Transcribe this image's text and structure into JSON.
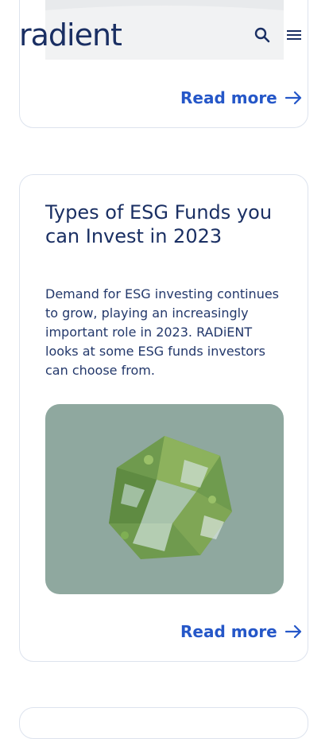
{
  "header": {
    "logo_text": "radient"
  },
  "cards": [
    {
      "read_more": "Read more"
    },
    {
      "title": "Types of ESG Funds you can Invest in 2023",
      "description": "Demand for ESG investing continues to grow, playing an increasingly important role in 2023. RADiENT looks at some ESG funds investors can choose from.",
      "read_more": "Read more"
    }
  ],
  "colors": {
    "accent": "#2557c8",
    "title": "#1a2f63",
    "image_bg": "#8fa89f"
  }
}
